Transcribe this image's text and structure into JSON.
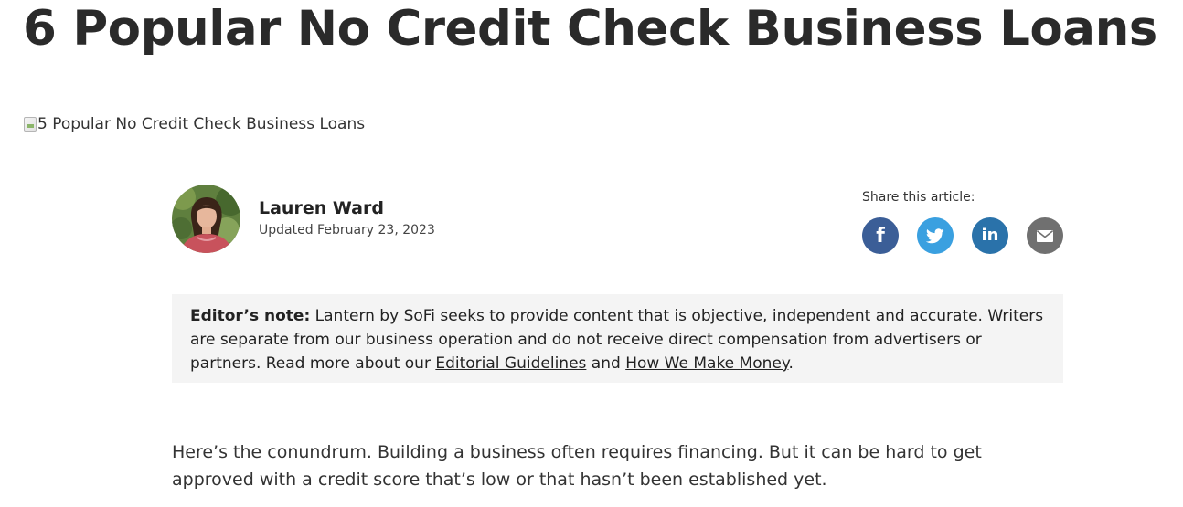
{
  "article": {
    "title": "6 Popular No Credit Check Business Loans",
    "hero_image_alt": "5 Popular No Credit Check Business Loans"
  },
  "author": {
    "name": "Lauren Ward",
    "updated": "Updated February 23, 2023",
    "avatar_icon": "author-photo"
  },
  "share": {
    "label": "Share this article:",
    "buttons": [
      {
        "name": "facebook",
        "icon": "facebook-icon",
        "color": "#3b5e97"
      },
      {
        "name": "twitter",
        "icon": "twitter-icon",
        "color": "#3aa0e0"
      },
      {
        "name": "linkedin",
        "icon": "linkedin-icon",
        "color": "#2a72aa"
      },
      {
        "name": "email",
        "icon": "email-icon",
        "color": "#707070"
      }
    ]
  },
  "editors_note": {
    "label": "Editor’s note:",
    "text_1": " Lantern by SoFi seeks to provide content that is objective, independent and accurate. Writers are separate from our business operation and do not receive direct compensation from advertisers or partners. Read more about our ",
    "link_1": "Editorial Guidelines",
    "text_2": " and ",
    "link_2": "How We Make Money",
    "text_3": "."
  },
  "body": {
    "paragraph_1": "Here’s the conundrum. Building a business often requires financing. But it can be hard to get approved with a credit score that’s low or that hasn’t been established yet."
  }
}
